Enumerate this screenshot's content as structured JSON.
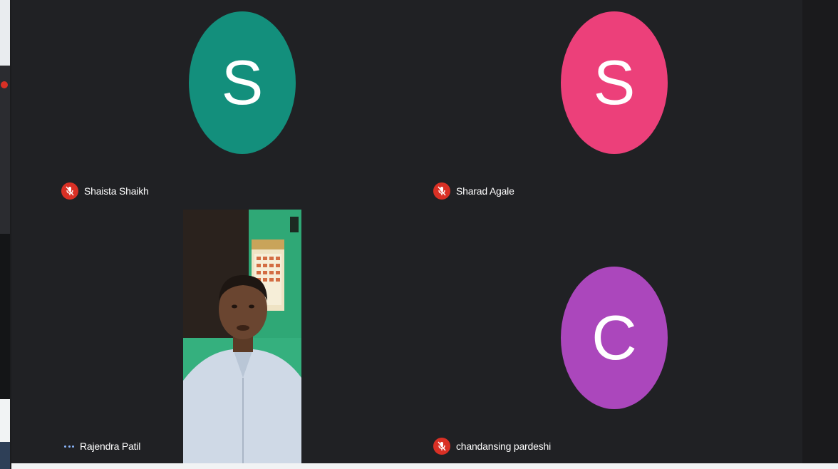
{
  "participants": [
    {
      "name": "Shaista Shaikh",
      "initial": "S",
      "avatar_color": "#138f7c",
      "mic": "muted"
    },
    {
      "name": "Sharad Agale",
      "initial": "S",
      "avatar_color": "#ec407a",
      "mic": "muted"
    },
    {
      "name": "Rajendra Patil",
      "initial": "",
      "avatar_color": "",
      "mic": "speaking",
      "video": "camera-on"
    },
    {
      "name": "chandansing pardeshi",
      "initial": "C",
      "avatar_color": "#ab47bc",
      "mic": "muted"
    }
  ],
  "icons": {
    "muted": "mic-off-icon",
    "speaking": "audio-level-icon"
  },
  "colors": {
    "meeting_background": "#202124",
    "mic_off_badge": "#d93025",
    "audio_indicator": "#8ab4f8"
  }
}
